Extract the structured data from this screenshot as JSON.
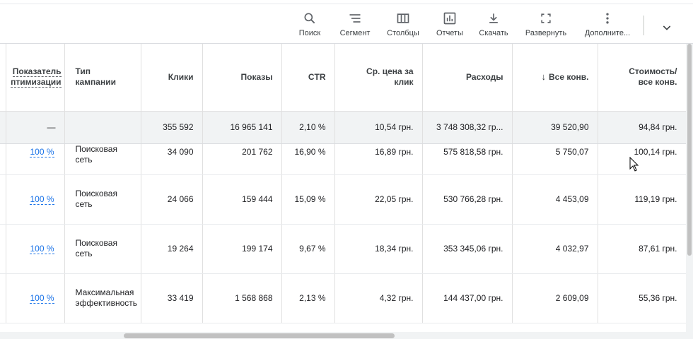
{
  "toolbar": {
    "items": [
      {
        "label": "Поиск",
        "icon": "search-icon"
      },
      {
        "label": "Сегмент",
        "icon": "segment-icon"
      },
      {
        "label": "Столбцы",
        "icon": "columns-icon"
      },
      {
        "label": "Отчеты",
        "icon": "reports-icon"
      },
      {
        "label": "Скачать",
        "icon": "download-icon"
      },
      {
        "label": "Развернуть",
        "icon": "fullscreen-icon"
      },
      {
        "label": "Дополните...",
        "icon": "more-vert-icon"
      }
    ],
    "expand_icon": "chevron-down-icon"
  },
  "table": {
    "headers": {
      "opt_line1": "Показатель",
      "opt_line2": "птимизации",
      "type_line1": "Тип",
      "type_line2": "кампании",
      "clicks": "Клики",
      "impr": "Показы",
      "ctr": "CTR",
      "cpc_line1": "Ср. цена за",
      "cpc_line2": "клик",
      "cost": "Расходы",
      "conv": "Все конв.",
      "cpa_line1": "Стоимость/",
      "cpa_line2": "все конв."
    },
    "total": {
      "opt": "—",
      "clicks": "355 592",
      "impr": "16 965 141",
      "ctr": "2,10 %",
      "cpc": "10,54 грн.",
      "cost": "3 748 308,32 гр...",
      "conv": "39 520,90",
      "cpa": "94,84 грн."
    },
    "rows": [
      {
        "opt": "100 %",
        "type1": "Поисковая",
        "type2": "сеть",
        "clicks": "34 090",
        "impr": "201 762",
        "ctr": "16,90 %",
        "cpc": "16,89 грн.",
        "cost": "575 818,58 грн.",
        "conv": "5 750,07",
        "cpa": "100,14 грн."
      },
      {
        "opt": "100 %",
        "type1": "Поисковая",
        "type2": "сеть",
        "clicks": "24 066",
        "impr": "159 444",
        "ctr": "15,09 %",
        "cpc": "22,05 грн.",
        "cost": "530 766,28 грн.",
        "conv": "4 453,09",
        "cpa": "119,19 грн."
      },
      {
        "opt": "100 %",
        "type1": "Поисковая",
        "type2": "сеть",
        "clicks": "19 264",
        "impr": "199 174",
        "ctr": "9,67 %",
        "cpc": "18,34 грн.",
        "cost": "353 345,06 грн.",
        "conv": "4 032,97",
        "cpa": "87,61 грн."
      },
      {
        "opt": "100 %",
        "type1": "Максимальная",
        "type2": "эффективность",
        "clicks": "33 419",
        "impr": "1 568 868",
        "ctr": "2,13 %",
        "cpc": "4,32 грн.",
        "cost": "144 437,00 грн.",
        "conv": "2 609,09",
        "cpa": "55,36 грн."
      }
    ]
  },
  "colors": {
    "link": "#1a73e8",
    "total_bg": "#f1f3f4",
    "border": "#e0e0e0"
  }
}
